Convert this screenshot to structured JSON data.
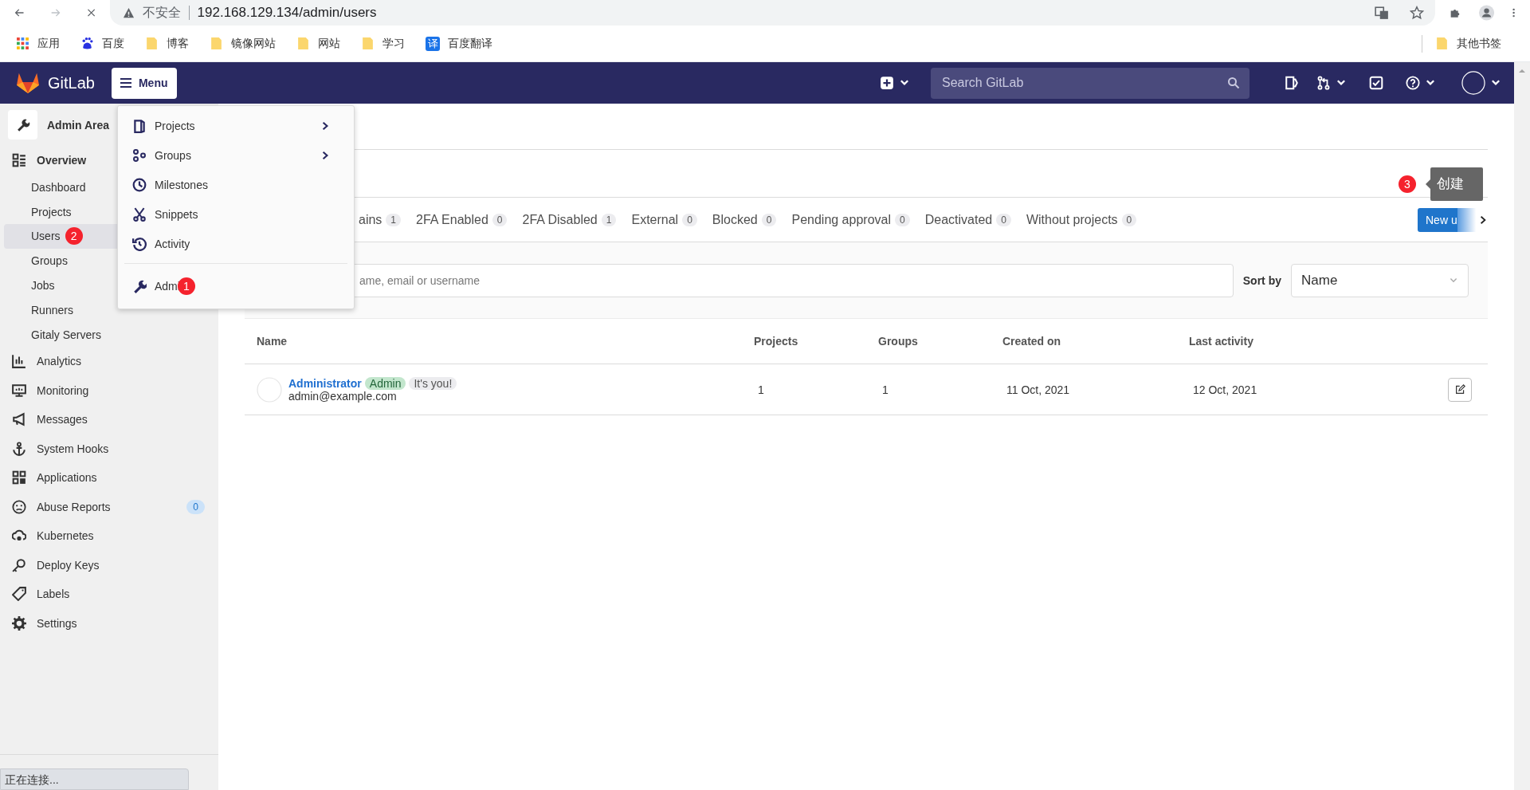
{
  "browser": {
    "address_warning": "不安全",
    "url": "192.168.129.134/admin/users",
    "bookmarks": [
      {
        "kind": "apps",
        "label": "应用"
      },
      {
        "kind": "paw",
        "label": "百度"
      },
      {
        "kind": "folder",
        "label": "博客"
      },
      {
        "kind": "folder",
        "label": "镜像网站"
      },
      {
        "kind": "folder",
        "label": "网站"
      },
      {
        "kind": "folder",
        "label": "学习"
      },
      {
        "kind": "translate",
        "glyph": "译",
        "label": "百度翻译"
      }
    ],
    "other_bookmarks": "其他书签",
    "status": "正在连接..."
  },
  "header": {
    "brand": "GitLab",
    "menu_button": "Menu",
    "search": {
      "placeholder": "Search GitLab"
    }
  },
  "menu": {
    "items": [
      {
        "kind": "projects",
        "label": "Projects",
        "submenu": true
      },
      {
        "kind": "groups",
        "label": "Groups",
        "submenu": true
      },
      {
        "kind": "milestones",
        "label": "Milestones",
        "submenu": false
      },
      {
        "kind": "snippets",
        "label": "Snippets",
        "submenu": false
      },
      {
        "kind": "activity",
        "label": "Activity",
        "submenu": false
      }
    ],
    "admin": {
      "label": "Admi",
      "annotation": "1"
    }
  },
  "sidebar": {
    "title": "Admin Area",
    "items": [
      {
        "kind": "overview",
        "label": "Overview",
        "selected": false,
        "children": [
          {
            "label": "Dashboard",
            "selected": false
          },
          {
            "label": "Projects",
            "selected": false
          },
          {
            "label": "Users",
            "selected": true,
            "annotation": "2"
          },
          {
            "label": "Groups",
            "selected": false
          },
          {
            "label": "Jobs",
            "selected": false
          },
          {
            "label": "Runners",
            "selected": false
          },
          {
            "label": "Gitaly Servers",
            "selected": false
          }
        ]
      },
      {
        "kind": "analytics",
        "label": "Analytics",
        "selected": false
      },
      {
        "kind": "monitoring",
        "label": "Monitoring",
        "selected": false
      },
      {
        "kind": "messages",
        "label": "Messages",
        "selected": false
      },
      {
        "kind": "hooks",
        "label": "System Hooks",
        "selected": false
      },
      {
        "kind": "applications",
        "label": "Applications",
        "selected": false
      },
      {
        "kind": "abuse",
        "label": "Abuse Reports",
        "selected": false,
        "count": "0"
      },
      {
        "kind": "kubernetes",
        "label": "Kubernetes",
        "selected": false
      },
      {
        "kind": "keys",
        "label": "Deploy Keys",
        "selected": false
      },
      {
        "kind": "labels",
        "label": "Labels",
        "selected": false
      },
      {
        "kind": "settings",
        "label": "Settings",
        "selected": false
      }
    ]
  },
  "tooltip": {
    "annotation": "3",
    "text": "创建"
  },
  "tabs": [
    {
      "label": "ains",
      "count": "1",
      "selected": false
    },
    {
      "label": "2FA Enabled",
      "count": "0",
      "selected": false
    },
    {
      "label": "2FA Disabled",
      "count": "1",
      "selected": false
    },
    {
      "label": "External",
      "count": "0",
      "selected": false
    },
    {
      "label": "Blocked",
      "count": "0",
      "selected": false
    },
    {
      "label": "Pending approval",
      "count": "0",
      "selected": false
    },
    {
      "label": "Deactivated",
      "count": "0",
      "selected": false
    },
    {
      "label": "Without projects",
      "count": "0",
      "selected": false
    }
  ],
  "new_user_button": "New u",
  "filter": {
    "search_placeholder": "ame, email or username",
    "sort_label": "Sort by",
    "sort_value": "Name"
  },
  "table": {
    "columns": [
      "Name",
      "Projects",
      "Groups",
      "Created on",
      "Last activity"
    ],
    "rows": [
      {
        "name": "Administrator",
        "badges": [
          {
            "kind": "admin",
            "label": "Admin"
          },
          {
            "kind": "self",
            "label": "It's you!"
          }
        ],
        "email": "admin@example.com",
        "projects": "1",
        "groups": "1",
        "created_on": "11 Oct, 2021",
        "last_activity": "12 Oct, 2021"
      }
    ]
  }
}
